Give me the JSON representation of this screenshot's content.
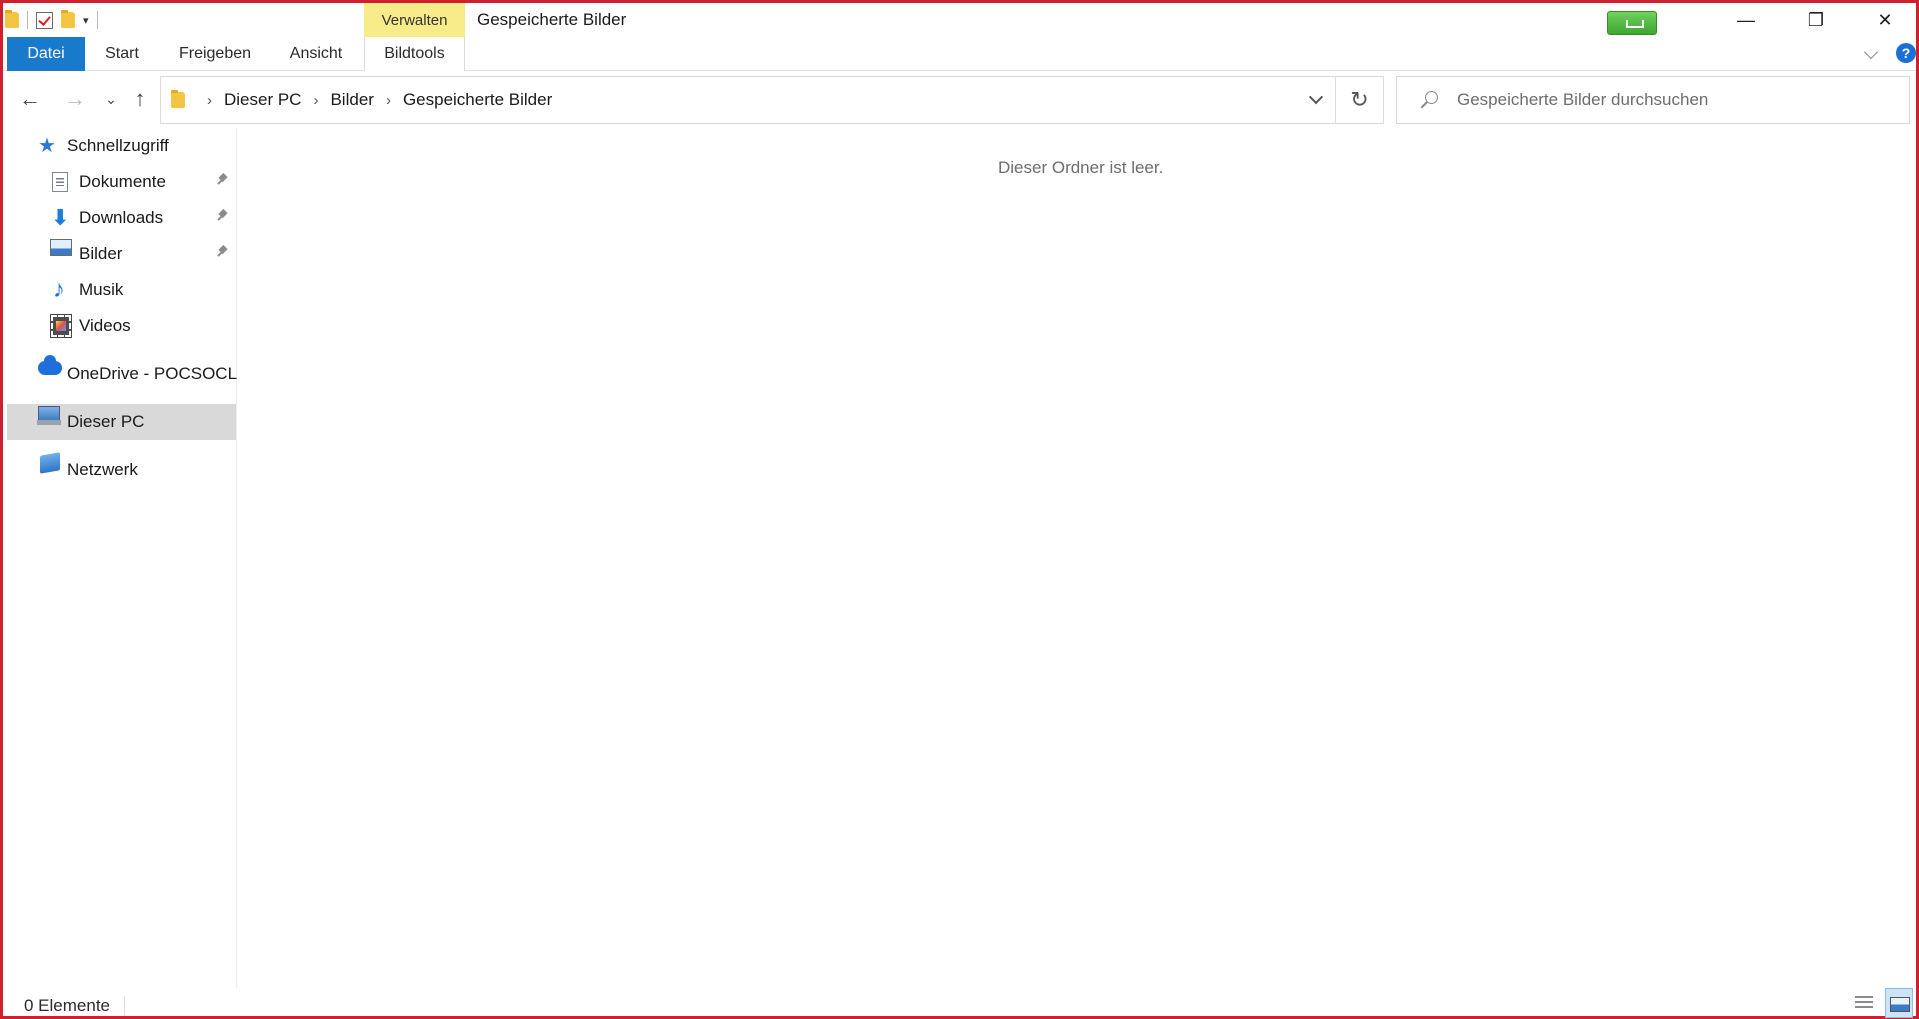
{
  "window": {
    "title": "Gespeicherte Bilder",
    "contextual_tab_group": "Verwalten",
    "controls": {
      "minimize": "—",
      "restore": "❐",
      "close": "✕"
    }
  },
  "ribbon": {
    "tabs": [
      {
        "label": "Datei",
        "active": true
      },
      {
        "label": "Start"
      },
      {
        "label": "Freigeben"
      },
      {
        "label": "Ansicht"
      },
      {
        "label": "Bildtools"
      }
    ],
    "help_label": "?"
  },
  "navigation": {
    "back_icon": "arrow-left-icon",
    "forward_icon": "arrow-right-icon",
    "recent_icon": "chevron-down-icon",
    "up_icon": "arrow-up-icon"
  },
  "address": {
    "crumbs": [
      "Dieser PC",
      "Bilder",
      "Gespeicherte Bilder"
    ],
    "separator": "›"
  },
  "search": {
    "placeholder": "Gespeicherte Bilder durchsuchen",
    "value": ""
  },
  "sidebar": {
    "items": [
      {
        "label": "Schnellzugriff",
        "icon": "star-icon",
        "pinned": false
      },
      {
        "label": "Dokumente",
        "icon": "document-icon",
        "pinned": true
      },
      {
        "label": "Downloads",
        "icon": "download-icon",
        "pinned": true
      },
      {
        "label": "Bilder",
        "icon": "pictures-icon",
        "pinned": true
      },
      {
        "label": "Musik",
        "icon": "music-icon",
        "pinned": false
      },
      {
        "label": "Videos",
        "icon": "video-icon",
        "pinned": false
      },
      {
        "label": "OneDrive - POCSOCL",
        "icon": "cloud-icon",
        "pinned": false
      },
      {
        "label": "Dieser PC",
        "icon": "computer-icon",
        "pinned": false,
        "selected": true
      },
      {
        "label": "Netzwerk",
        "icon": "network-icon",
        "pinned": false
      }
    ]
  },
  "content": {
    "empty_message": "Dieser Ordner ist leer."
  },
  "status": {
    "item_count": "0 Elemente"
  },
  "colors": {
    "file_tab": "#1979ca",
    "contextual_tab": "#f8eb89",
    "window_border": "#d0202f",
    "selected_nav": "#d9d9d9"
  }
}
